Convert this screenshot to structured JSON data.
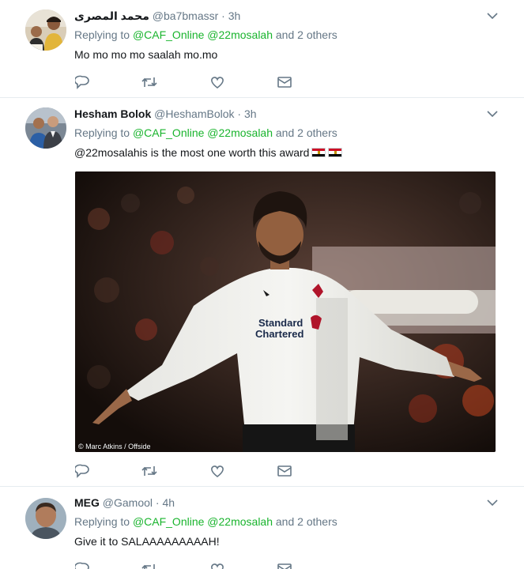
{
  "colors": {
    "mention": "#19b42d",
    "secondary_text": "#657786",
    "primary_text": "#14171a",
    "divider": "#e6ecf0"
  },
  "tweets": [
    {
      "fullname": "محمد المصرى",
      "username": "@ba7bmassr",
      "dot": "·",
      "time": "3h",
      "replying_prefix": "Replying to",
      "mention_1": "@CAF_Online",
      "mention_2": "@22mosalah",
      "others": "and 2 others",
      "text": "Mo mo mo mo saalah mo.mo"
    },
    {
      "fullname": "Hesham Bolok",
      "username": "@HeshamBolok",
      "dot": "·",
      "time": "3h",
      "replying_prefix": "Replying to",
      "mention_1": "@CAF_Online",
      "mention_2": "@22mosalah",
      "others": "and 2 others",
      "text": "@22mosalahis is the most one worth this award",
      "flags": [
        "egypt-flag",
        "egypt-flag"
      ],
      "photo": {
        "credit": "© Marc Atkins / Offside",
        "shirt_sponsor_1": "Standard",
        "shirt_sponsor_2": "Chartered"
      }
    },
    {
      "fullname": "MEG",
      "username": "@Gamool",
      "dot": "·",
      "time": "4h",
      "replying_prefix": "Replying to",
      "mention_1": "@CAF_Online",
      "mention_2": "@22mosalah",
      "others": "and 2 others",
      "text": "Give it to SALAAAAAAAAAH!"
    }
  ],
  "action_icons": [
    "reply-icon",
    "retweet-icon",
    "like-icon",
    "direct-message-icon"
  ],
  "header_icon": "chevron-down-icon"
}
